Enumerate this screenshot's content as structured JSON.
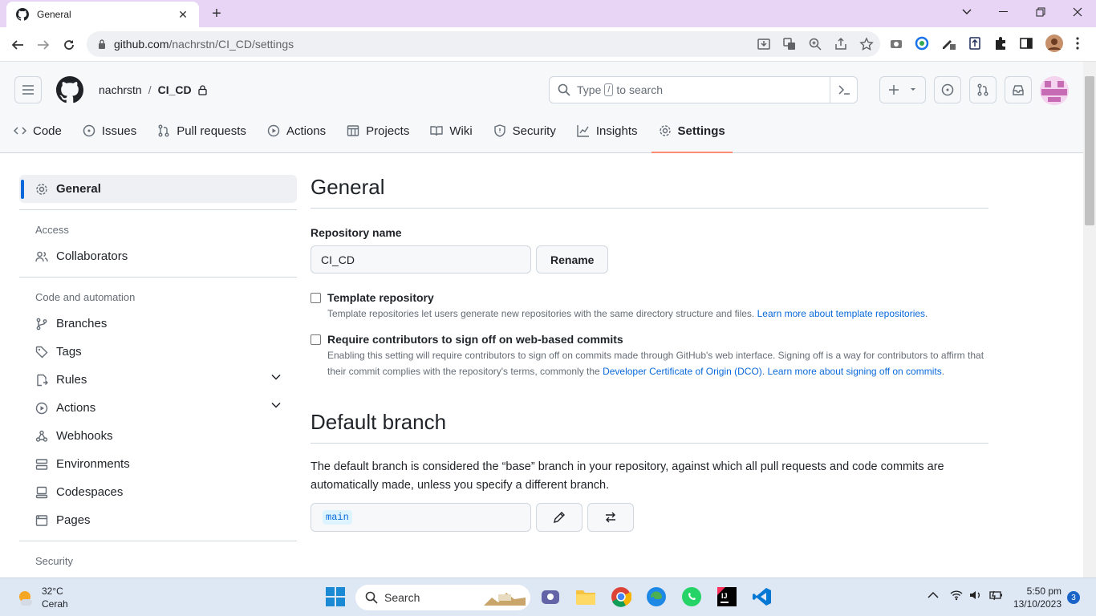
{
  "browser": {
    "tab_title": "General",
    "url_host": "github.com",
    "url_path": "/nachrstn/CI_CD/settings"
  },
  "header": {
    "owner": "nachrstn",
    "separator": "/",
    "repo": "CI_CD",
    "search_prefix": "Type",
    "search_key": "/",
    "search_suffix": "to search"
  },
  "repo_nav": [
    {
      "label": "Code",
      "icon": "code-icon"
    },
    {
      "label": "Issues",
      "icon": "issue-icon"
    },
    {
      "label": "Pull requests",
      "icon": "pull-request-icon"
    },
    {
      "label": "Actions",
      "icon": "play-icon"
    },
    {
      "label": "Projects",
      "icon": "table-icon"
    },
    {
      "label": "Wiki",
      "icon": "book-icon"
    },
    {
      "label": "Security",
      "icon": "shield-icon"
    },
    {
      "label": "Insights",
      "icon": "graph-icon"
    },
    {
      "label": "Settings",
      "icon": "gear-icon",
      "active": true
    }
  ],
  "sidebar": {
    "general": "General",
    "access_heading": "Access",
    "collaborators": "Collaborators",
    "code_heading": "Code and automation",
    "items": [
      "Branches",
      "Tags",
      "Rules",
      "Actions",
      "Webhooks",
      "Environments",
      "Codespaces",
      "Pages"
    ],
    "security_heading": "Security"
  },
  "main": {
    "title": "General",
    "repo_name_label": "Repository name",
    "repo_name_value": "CI_CD",
    "rename_button": "Rename",
    "template_title": "Template repository",
    "template_desc": "Template repositories let users generate new repositories with the same directory structure and files.",
    "template_link": "Learn more about template repositories",
    "signoff_title": "Require contributors to sign off on web-based commits",
    "signoff_desc_1": "Enabling this setting will require contributors to sign off on commits made through GitHub's web interface. Signing off is a way for contributors to affirm that their commit complies with the repository's terms, commonly the",
    "signoff_link_1": "Developer Certificate of Origin (DCO)",
    "signoff_link_2": "Learn more about signing off on commits",
    "default_branch_title": "Default branch",
    "default_branch_desc": "The default branch is considered the “base” branch in your repository, against which all pull requests and code commits are automatically made, unless you specify a different branch.",
    "branch_value": "main"
  },
  "taskbar": {
    "temperature": "32°C",
    "weather": "Cerah",
    "search": "Search",
    "time": "5:50 pm",
    "date": "13/10/2023",
    "notifications": "3"
  },
  "colors": {
    "accent": "#0969da",
    "active_tab_underline": "#fd8c73",
    "tabstrip": "#e8d5f5"
  }
}
